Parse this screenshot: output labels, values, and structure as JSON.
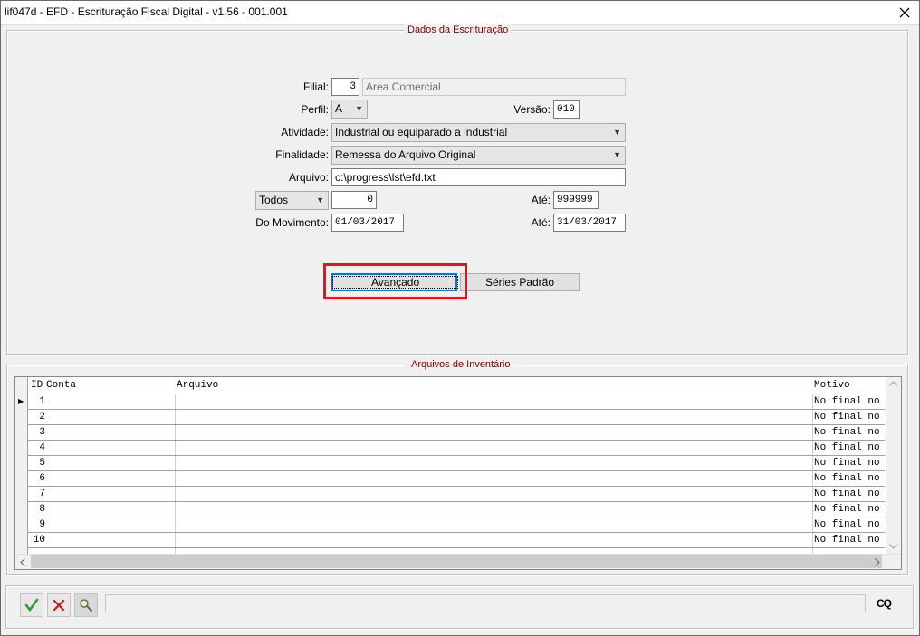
{
  "window": {
    "title": "lif047d - EFD - Escrituração Fiscal Digital - v1.56 - 001.001",
    "close_icon": "close-icon"
  },
  "dados": {
    "legend": "Dados da Escrituração",
    "filial_label": "Filial:",
    "filial_code": "3",
    "filial_name": "Area Comercial",
    "perfil_label": "Perfil:",
    "perfil_value": "A",
    "versao_label": "Versão:",
    "versao_value": "010",
    "atividade_label": "Atividade:",
    "atividade_value": "Industrial ou equiparado a industrial",
    "finalidade_label": "Finalidade:",
    "finalidade_value": "Remessa do Arquivo Original",
    "arquivo_label": "Arquivo:",
    "arquivo_value": "c:\\progress\\lst\\efd.txt",
    "filtro_value": "Todos",
    "filtro_de": "0",
    "ate_label": "Até:",
    "filtro_ate": "999999",
    "movimento_label": "Do Movimento:",
    "movimento_de": "01/03/2017",
    "movimento_ate_label": "Até:",
    "movimento_ate": "31/03/2017",
    "avancado_button": "Avançado",
    "series_button": "Séries Padrão"
  },
  "inventario": {
    "legend": "Arquivos de Inventário",
    "columns": [
      "ID",
      "Conta",
      "Arquivo",
      "Motivo"
    ],
    "rows": [
      {
        "id": "1",
        "conta": "",
        "arquivo": "",
        "motivo": "No final no"
      },
      {
        "id": "2",
        "conta": "",
        "arquivo": "",
        "motivo": "No final no"
      },
      {
        "id": "3",
        "conta": "",
        "arquivo": "",
        "motivo": "No final no"
      },
      {
        "id": "4",
        "conta": "",
        "arquivo": "",
        "motivo": "No final no"
      },
      {
        "id": "5",
        "conta": "",
        "arquivo": "",
        "motivo": "No final no"
      },
      {
        "id": "6",
        "conta": "",
        "arquivo": "",
        "motivo": "No final no"
      },
      {
        "id": "7",
        "conta": "",
        "arquivo": "",
        "motivo": "No final no"
      },
      {
        "id": "8",
        "conta": "",
        "arquivo": "",
        "motivo": "No final no"
      },
      {
        "id": "9",
        "conta": "",
        "arquivo": "",
        "motivo": "No final no"
      },
      {
        "id": "10",
        "conta": "",
        "arquivo": "",
        "motivo": "No final no"
      }
    ]
  },
  "toolbar": {
    "confirm_icon": "checkmark-icon",
    "cancel_icon": "x-icon",
    "search_icon": "magnifier-icon",
    "brand": "CQ"
  },
  "colors": {
    "legend": "#800000",
    "highlight": "#e3141c",
    "confirm": "#2e9e2e",
    "cancel": "#d01818"
  }
}
